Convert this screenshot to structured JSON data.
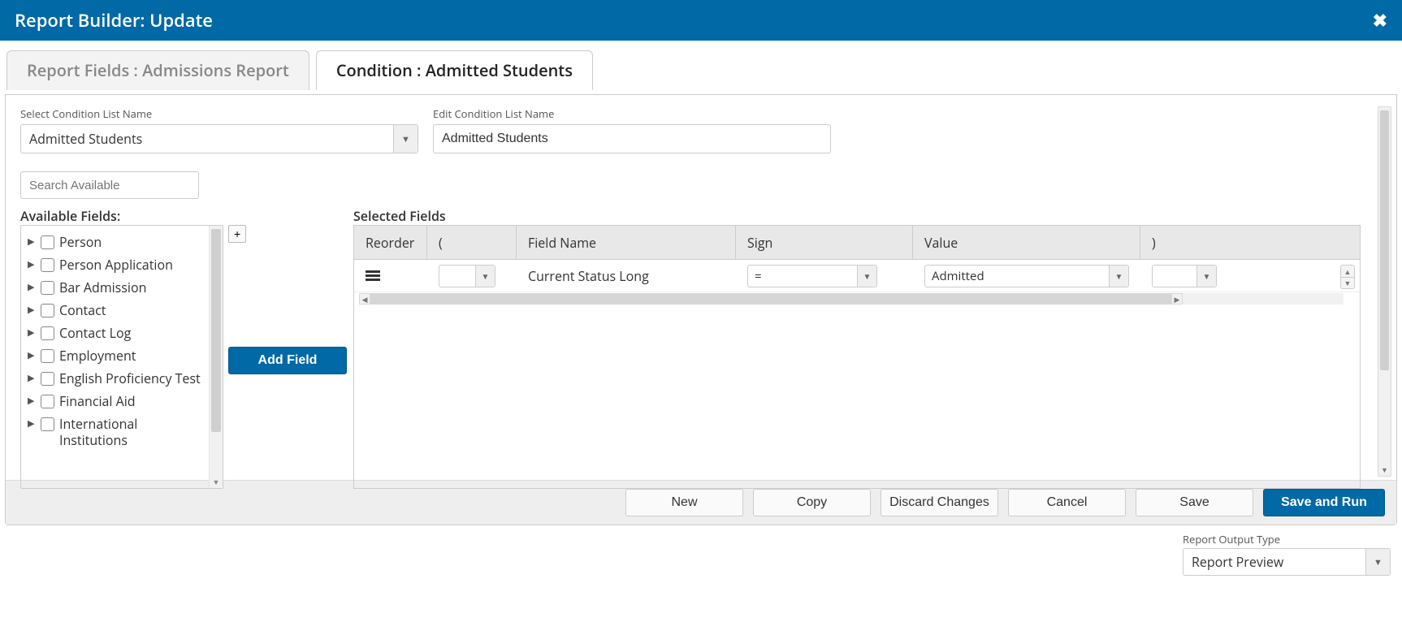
{
  "header": {
    "title": "Report Builder: Update",
    "close_tooltip": "Close"
  },
  "tabs": {
    "fields": "Report Fields : Admissions Report",
    "condition": "Condition : Admitted Students"
  },
  "labels": {
    "select_condition": "Select Condition List Name",
    "edit_condition": "Edit Condition List Name",
    "search_placeholder": "Search Available",
    "available_fields": "Available Fields:",
    "selected_fields": "Selected Fields",
    "add_field": "Add Field",
    "output_type": "Report Output Type"
  },
  "condition_select": {
    "value": "Admitted Students"
  },
  "condition_edit": {
    "value": "Admitted Students"
  },
  "output_type_value": "Report Preview",
  "available_fields": [
    "Person",
    "Person Application",
    "Bar Admission",
    "Contact",
    "Contact Log",
    "Employment",
    "English Proficiency Test",
    "Financial Aid",
    "International Institutions"
  ],
  "grid": {
    "headers": {
      "reorder": "Reorder",
      "open_paren": "(",
      "field_name": "Field Name",
      "sign": "Sign",
      "value": "Value",
      "close_paren": ")"
    },
    "rows": [
      {
        "open_paren": "",
        "field_name": "Current Status Long",
        "sign": "=",
        "value": "Admitted",
        "close_paren": ""
      }
    ]
  },
  "buttons": {
    "new": "New",
    "copy": "Copy",
    "discard": "Discard Changes",
    "cancel": "Cancel",
    "save": "Save",
    "save_run": "Save and Run",
    "plus": "+"
  }
}
